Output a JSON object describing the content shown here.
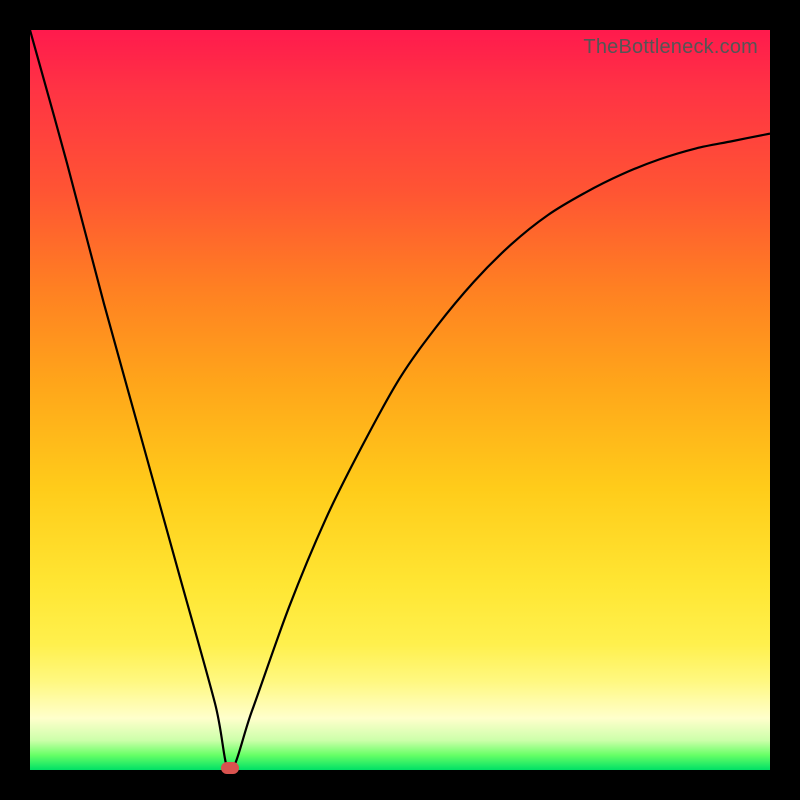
{
  "watermark": "TheBottleneck.com",
  "colors": {
    "frame": "#000000",
    "curve": "#000000",
    "marker": "#d9534f"
  },
  "chart_data": {
    "type": "line",
    "title": "",
    "xlabel": "",
    "ylabel": "",
    "xlim": [
      0,
      100
    ],
    "ylim": [
      0,
      100
    ],
    "grid": false,
    "legend": false,
    "series": [
      {
        "name": "bottleneck-curve",
        "x": [
          0,
          5,
          10,
          15,
          20,
          25,
          27,
          30,
          35,
          40,
          45,
          50,
          55,
          60,
          65,
          70,
          75,
          80,
          85,
          90,
          95,
          100
        ],
        "y": [
          100,
          82,
          63,
          45,
          27,
          9,
          0,
          8,
          22,
          34,
          44,
          53,
          60,
          66,
          71,
          75,
          78,
          80.5,
          82.5,
          84,
          85,
          86
        ]
      }
    ],
    "marker": {
      "x": 27,
      "y": 0
    },
    "gradient_stops": [
      {
        "pos": 0,
        "color": "#ff1a4d"
      },
      {
        "pos": 22,
        "color": "#ff5533"
      },
      {
        "pos": 48,
        "color": "#ffa61a"
      },
      {
        "pos": 75,
        "color": "#ffe633"
      },
      {
        "pos": 93,
        "color": "#ffffcc"
      },
      {
        "pos": 100,
        "color": "#00e066"
      }
    ]
  }
}
